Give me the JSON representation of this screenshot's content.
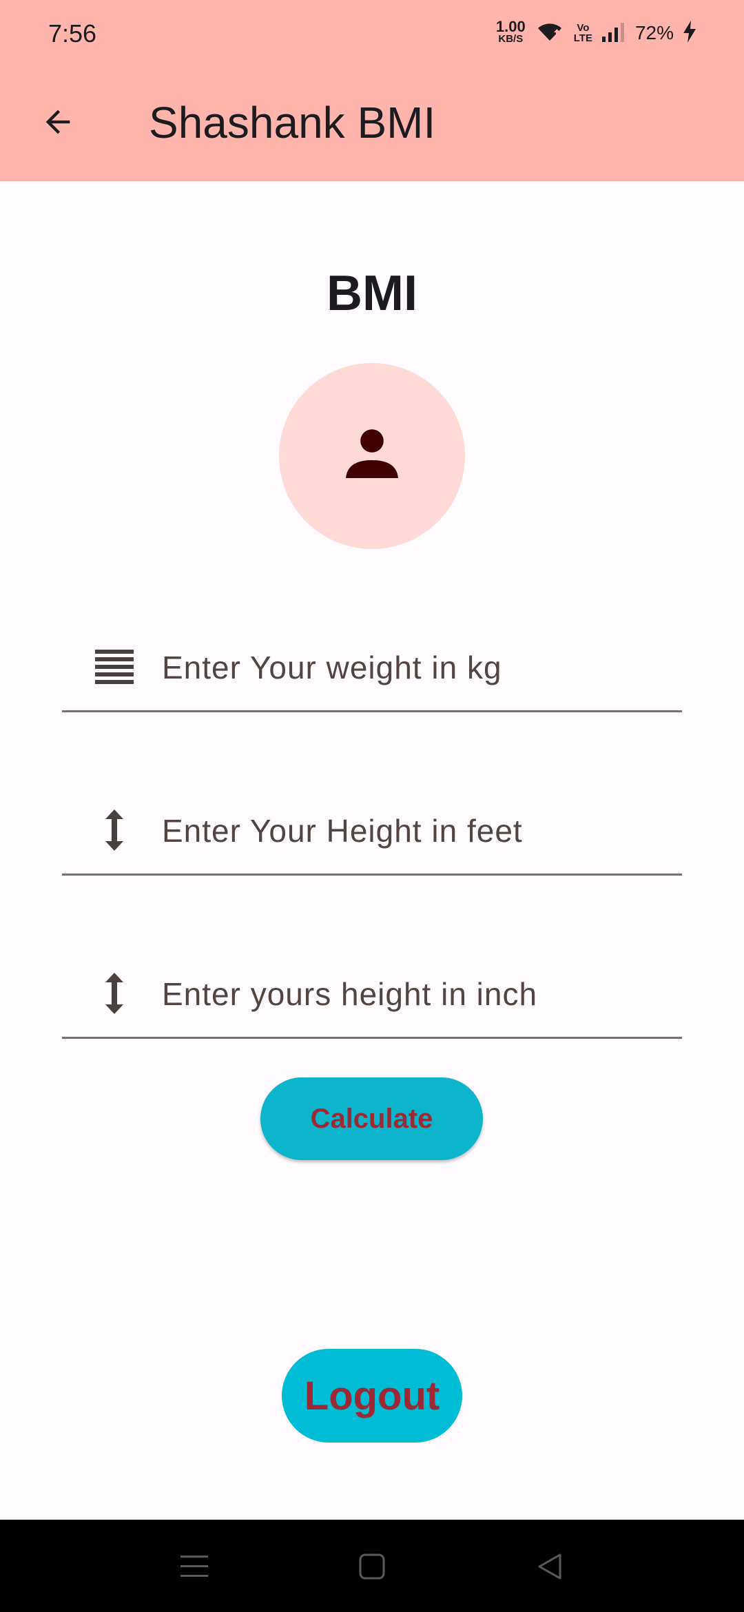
{
  "status_bar": {
    "time": "7:56",
    "net_speed_value": "1.00",
    "net_speed_unit": "KB/S",
    "volte_top": "Vo",
    "volte_bottom": "LTE",
    "battery": "72%"
  },
  "app_bar": {
    "title": "Shashank BMI",
    "back_icon": "arrow-back-icon"
  },
  "main": {
    "heading": "BMI",
    "avatar_icon": "person-icon",
    "fields": [
      {
        "icon": "format-align-justify-icon",
        "value": "",
        "placeholder": "Enter Your weight in kg"
      },
      {
        "icon": "height-icon",
        "value": "",
        "placeholder": "Enter Your Height in feet"
      },
      {
        "icon": "height-icon",
        "value": "",
        "placeholder": "Enter yours height in inch"
      }
    ],
    "calculate_label": "Calculate",
    "logout_label": "Logout"
  },
  "nav_bar": {
    "icons": [
      "menu-icon",
      "home-square-icon",
      "back-triangle-icon"
    ]
  },
  "colors": {
    "app_bar_bg": "#ffb4ac",
    "page_bg": "#fffbfe",
    "avatar_bg": "#ffdad6",
    "avatar_icon": "#410002",
    "button_bg": "#00bcd4",
    "button_text": "#9c2a35"
  }
}
